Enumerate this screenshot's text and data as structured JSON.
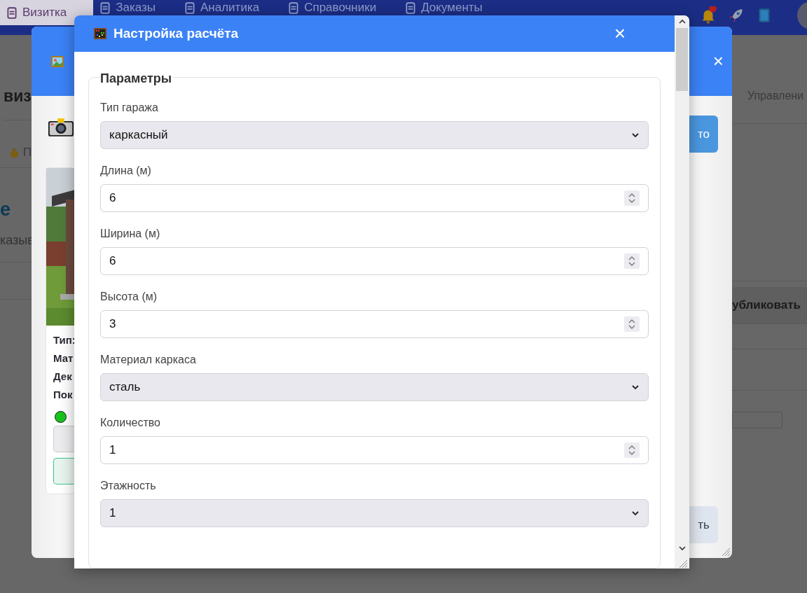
{
  "nav": {
    "tabs": [
      {
        "label": "Визитка",
        "selected": true
      },
      {
        "label": "Заказы",
        "selected": false
      },
      {
        "label": "Аналитика",
        "selected": false
      },
      {
        "label": "Справочники",
        "selected": false
      },
      {
        "label": "Документы",
        "selected": false
      }
    ]
  },
  "page": {
    "heading": "виз",
    "budget_label": "П",
    "section_heading": "е",
    "hint": "казыв",
    "right_tab": "Управлени",
    "publish": "убликовать"
  },
  "back_dialog": {
    "close": "×",
    "card_rows": [
      "Тип:",
      "Мат",
      "Дек",
      "Пок"
    ],
    "top_button": "то",
    "bottom_button": "ть"
  },
  "dialog": {
    "title": "Настройка расчёта",
    "close": "×",
    "legend": "Параметры",
    "fields": [
      {
        "label": "Тип гаража",
        "kind": "select",
        "value": "каркасный"
      },
      {
        "label": "Длина (м)",
        "kind": "number",
        "value": "6"
      },
      {
        "label": "Ширина (м)",
        "kind": "number",
        "value": "6"
      },
      {
        "label": "Высота (м)",
        "kind": "number",
        "value": "3"
      },
      {
        "label": "Материал каркаса",
        "kind": "select",
        "value": "сталь"
      },
      {
        "label": "Количество",
        "kind": "number",
        "value": "1"
      },
      {
        "label": "Этажность",
        "kind": "select",
        "value": "1"
      }
    ]
  }
}
